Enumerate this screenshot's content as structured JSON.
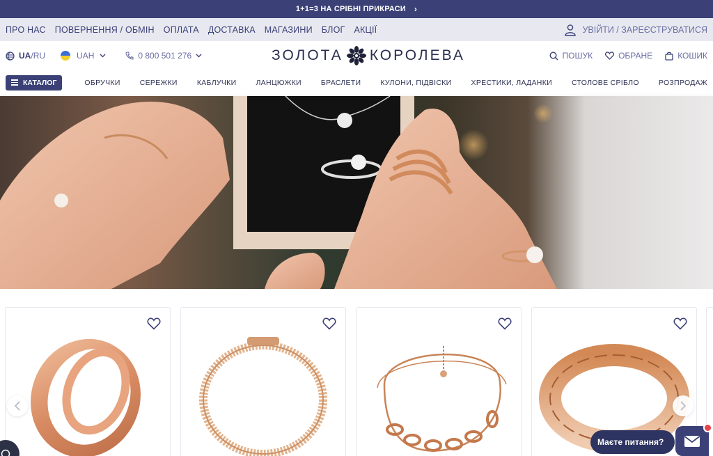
{
  "promo": {
    "text": "1+1=3 НА СРІБНІ ПРИКРАСИ",
    "chevron": "›"
  },
  "topnav": {
    "links": [
      "ПРО НАС",
      "ПОВЕРНЕННЯ / ОБМІН",
      "ОПЛАТА",
      "ДОСТАВКА",
      "МАГАЗИНИ",
      "БЛОГ",
      "АКЦІЇ"
    ],
    "login": "УВІЙТИ / ЗАРЕЄСТРУВАТИСЯ"
  },
  "header": {
    "lang_active": "UA",
    "lang_sep": " / ",
    "lang_other": "RU",
    "currency": "UAH",
    "phone": "0 800 501 276",
    "logo_left": "ЗОЛОТА",
    "logo_right": "КОРОЛЕВА",
    "search": "ПОШУК",
    "favorites": "ОБРАНЕ",
    "cart": "КОШИК"
  },
  "catnav": {
    "catalog": "КАТАЛОГ",
    "items": [
      "ОБРУЧКИ",
      "СЕРЕЖКИ",
      "КАБЛУЧКИ",
      "ЛАНЦЮЖКИ",
      "БРАСЛЕТИ",
      "КУЛОНИ, ПІДВІСКИ",
      "ХРЕСТИКИ, ЛАДАНКИ",
      "СТОЛОВЕ СРІБЛО",
      "РОЗПРОДАЖ"
    ]
  },
  "products": [
    {
      "icon": "ring-image"
    },
    {
      "icon": "bracelet-chain-image"
    },
    {
      "icon": "bracelet-double-chain-image"
    },
    {
      "icon": "bracelet-curb-image"
    }
  ],
  "chat": {
    "label": "Маєте питання?"
  },
  "colors": {
    "brand": "#3b4177",
    "gold": "#d59a74",
    "alert": "#e8434c"
  }
}
